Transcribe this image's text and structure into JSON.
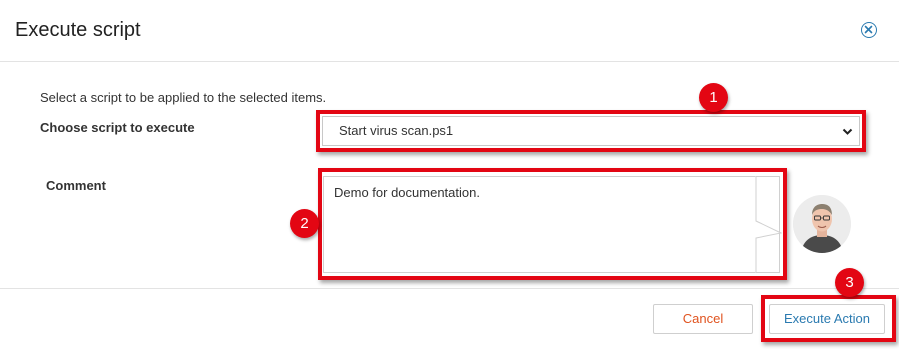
{
  "dialog": {
    "title": "Execute script"
  },
  "form": {
    "intro": "Select a script to be applied to the selected items.",
    "script_label": "Choose script to execute",
    "script_selected": "Start virus scan.ps1",
    "comment_label": "Comment",
    "comment_value": "Demo for documentation."
  },
  "actions": {
    "cancel_label": "Cancel",
    "execute_label": "Execute Action"
  },
  "callouts": [
    "1",
    "2",
    "3"
  ],
  "colors": {
    "callout_red": "#e30613",
    "accent_blue": "#2a7ab0",
    "cancel_orange": "#e0531f"
  },
  "icons": [
    "close-icon",
    "chevron-down-icon"
  ]
}
